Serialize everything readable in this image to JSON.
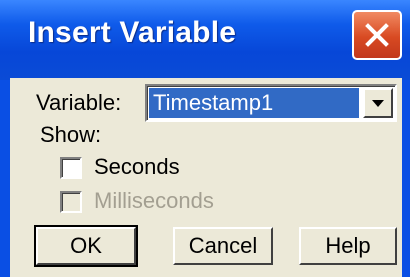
{
  "window": {
    "title": "Insert Variable",
    "close_icon": "close-icon"
  },
  "form": {
    "variable_label": "Variable:",
    "variable_value": "Timestamp1",
    "show_label": "Show:",
    "seconds_label": "Seconds",
    "seconds_checked": false,
    "milliseconds_label": "Milliseconds",
    "milliseconds_checked": false,
    "milliseconds_enabled": false
  },
  "buttons": {
    "ok": "OK",
    "cancel": "Cancel",
    "help": "Help"
  },
  "colors": {
    "titlebar": "#0a4bd6",
    "close": "#d84a22",
    "face": "#ece9d8",
    "selection": "#316ac5"
  }
}
